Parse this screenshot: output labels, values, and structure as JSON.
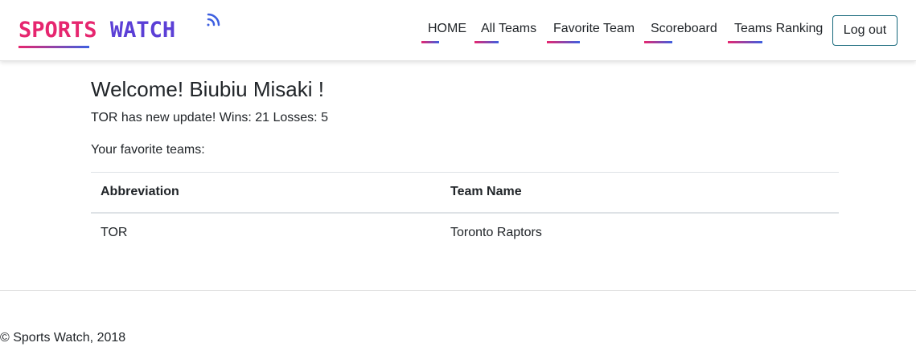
{
  "brand": {
    "part1": "SPORTS",
    "part2": "WATCH"
  },
  "nav": {
    "items": [
      {
        "label": "HOME"
      },
      {
        "label": "All Teams"
      },
      {
        "label": "Favorite Team"
      },
      {
        "label": "Scoreboard"
      },
      {
        "label": "Teams Ranking"
      }
    ],
    "logout_label": "Log out"
  },
  "main": {
    "welcome": "Welcome! Biubiu Misaki !",
    "update": "TOR has new update! Wins: 21 Losses: 5",
    "favorites_label": "Your favorite teams:",
    "table": {
      "headers": [
        "Abbreviation",
        "Team Name"
      ],
      "rows": [
        [
          "TOR",
          "Toronto Raptors"
        ]
      ]
    }
  },
  "footer": {
    "text": "© Sports Watch, 2018"
  },
  "colors": {
    "accent_pink": "#e6266f",
    "accent_blue": "#3d5fe0",
    "button_border": "#17697c"
  }
}
